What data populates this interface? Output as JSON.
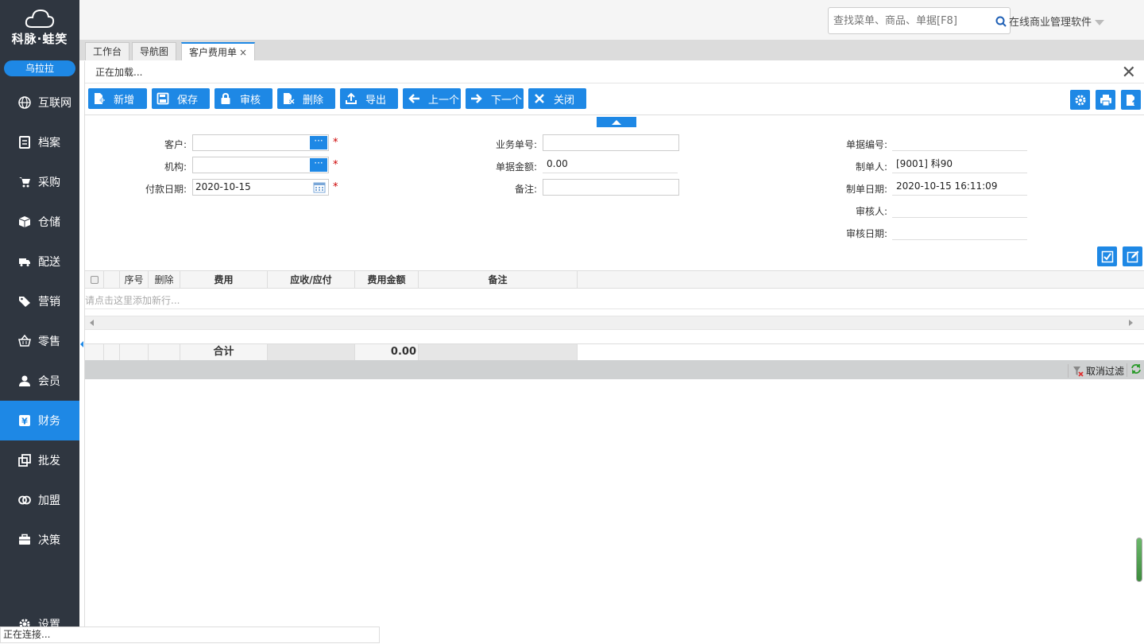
{
  "sidebar": {
    "brand": "科脉·蛙笑",
    "user": "乌拉拉",
    "items": [
      {
        "label": "互联网",
        "icon": "globe-icon"
      },
      {
        "label": "档案",
        "icon": "archive-icon"
      },
      {
        "label": "采购",
        "icon": "cart-icon"
      },
      {
        "label": "仓储",
        "icon": "box-icon"
      },
      {
        "label": "配送",
        "icon": "truck-icon"
      },
      {
        "label": "营销",
        "icon": "tag-icon"
      },
      {
        "label": "零售",
        "icon": "basket-icon"
      },
      {
        "label": "会员",
        "icon": "user-icon"
      },
      {
        "label": "财务",
        "icon": "yen-icon"
      },
      {
        "label": "批发",
        "icon": "copy-icon"
      },
      {
        "label": "加盟",
        "icon": "rings-icon"
      },
      {
        "label": "决策",
        "icon": "briefcase-icon"
      }
    ],
    "settings": "设置",
    "active_color": "#1e88e5"
  },
  "topbar": {
    "search_placeholder": "查找菜单、商品、单据[F8]",
    "app_name": "在线商业管理软件"
  },
  "tabs": [
    {
      "label": "工作台"
    },
    {
      "label": "导航图"
    },
    {
      "label": "客户费用单",
      "close": "×"
    }
  ],
  "panel": {
    "loading": "正在加载...",
    "close": "✕"
  },
  "toolbar": {
    "new": "新增",
    "save": "保存",
    "audit": "审核",
    "delete": "删除",
    "export": "导出",
    "prev": "上一个",
    "next": "下一个",
    "close": "关闭"
  },
  "form": {
    "customer_label": "客户:",
    "customer_value": "",
    "org_label": "机构:",
    "org_value": "",
    "paydate_label": "付款日期:",
    "paydate_value": "2020-10-15",
    "bizno_label": "业务单号:",
    "bizno_value": "",
    "amount_label": "单据金额:",
    "amount_value": "0.00",
    "remark_label": "备注:",
    "remark_value": "",
    "docno_label": "单据编号:",
    "docno_value": "",
    "maker_label": "制单人:",
    "maker_value": "[9001] 科90",
    "makedate_label": "制单日期:",
    "makedate_value": "2020-10-15 16:11:09",
    "auditor_label": "审核人:",
    "auditor_value": "",
    "auditdate_label": "审核日期:",
    "auditdate_value": "",
    "required_mark": "*",
    "dots": "···"
  },
  "grid": {
    "columns": [
      "序号",
      "删除",
      "费用",
      "应收/应付",
      "费用金额",
      "备注"
    ],
    "add_hint": "请点击这里添加新行...",
    "total_label": "合计",
    "total_amount": "0.00",
    "cancel_filter": "取消过滤"
  },
  "status": {
    "connecting": "正在连接..."
  }
}
